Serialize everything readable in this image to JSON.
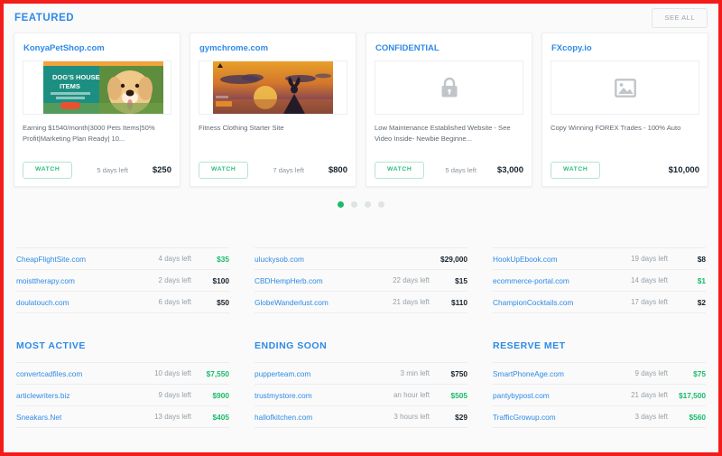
{
  "featured": {
    "title": "FEATURED",
    "see_all_label": "SEE ALL",
    "cards": [
      {
        "name": "KonyaPetShop.com",
        "thumb": "dog-pet-shop-banner",
        "description": "Earning $1540/month|3000 Pets Items|50% Profit|Marketing Plan Ready| 10...",
        "watch_label": "WATCH",
        "time_left": "5 days left",
        "price": "$250"
      },
      {
        "name": "gymchrome.com",
        "thumb": "yoga-sunset-banner",
        "description": "Fitness Clothing Starter Site",
        "watch_label": "WATCH",
        "time_left": "7 days left",
        "price": "$800"
      },
      {
        "name": "CONFIDENTIAL",
        "thumb": "lock-icon",
        "description": "Low Maintenance Established Website - See Video Inside- Newbie Beginne...",
        "watch_label": "WATCH",
        "time_left": "5 days left",
        "price": "$3,000"
      },
      {
        "name": "FXcopy.io",
        "thumb": "image-placeholder-icon",
        "description": "Copy Winning FOREX Trades - 100% Auto",
        "watch_label": "WATCH",
        "time_left": "",
        "price": "$10,000"
      }
    ],
    "dots": {
      "count": 4,
      "active_index": 0
    }
  },
  "mid_listings": [
    {
      "rows": [
        {
          "name": "CheapFlightSite.com",
          "time_left": "4 days left",
          "price": "$35",
          "price_color": "green"
        },
        {
          "name": "moisttherapy.com",
          "time_left": "2 days left",
          "price": "$100",
          "price_color": "dark"
        },
        {
          "name": "doulatouch.com",
          "time_left": "6 days left",
          "price": "$50",
          "price_color": "dark"
        }
      ]
    },
    {
      "rows": [
        {
          "name": "uluckysob.com",
          "time_left": "",
          "price": "$29,000",
          "price_color": "dark"
        },
        {
          "name": "CBDHempHerb.com",
          "time_left": "22 days left",
          "price": "$15",
          "price_color": "dark"
        },
        {
          "name": "GlobeWanderlust.com",
          "time_left": "21 days left",
          "price": "$110",
          "price_color": "dark"
        }
      ]
    },
    {
      "rows": [
        {
          "name": "HookUpEbook.com",
          "time_left": "19 days left",
          "price": "$8",
          "price_color": "dark"
        },
        {
          "name": "ecommerce-portal.com",
          "time_left": "14 days left",
          "price": "$1",
          "price_color": "green"
        },
        {
          "name": "ChampionCocktails.com",
          "time_left": "17 days left",
          "price": "$2",
          "price_color": "dark"
        }
      ]
    }
  ],
  "bottom_sections": [
    {
      "title": "MOST ACTIVE",
      "rows": [
        {
          "name": "convertcadfiles.com",
          "time_left": "10 days left",
          "price": "$7,550",
          "price_color": "green"
        },
        {
          "name": "articlewriters.biz",
          "time_left": "9 days left",
          "price": "$900",
          "price_color": "green"
        },
        {
          "name": "Sneakars.Net",
          "time_left": "13 days left",
          "price": "$405",
          "price_color": "green"
        }
      ]
    },
    {
      "title": "ENDING SOON",
      "rows": [
        {
          "name": "pupperteam.com",
          "time_left": "3 min left",
          "price": "$750",
          "price_color": "dark"
        },
        {
          "name": "trustmystore.com",
          "time_left": "an hour left",
          "price": "$505",
          "price_color": "green"
        },
        {
          "name": "hallofkitchen.com",
          "time_left": "3 hours left",
          "price": "$29",
          "price_color": "dark"
        }
      ]
    },
    {
      "title": "RESERVE MET",
      "rows": [
        {
          "name": "SmartPhoneAge.com",
          "time_left": "9 days left",
          "price": "$75",
          "price_color": "green"
        },
        {
          "name": "pantybypost.com",
          "time_left": "21 days left",
          "price": "$17,500",
          "price_color": "green"
        },
        {
          "name": "TrafficGrowup.com",
          "time_left": "3 days left",
          "price": "$560",
          "price_color": "green"
        }
      ]
    }
  ],
  "thumb_art": {
    "dog_banner_headline": "DOG'S HOUSE",
    "dog_banner_subhead": "ITEMS"
  },
  "colors": {
    "link_blue": "#2e8ae6",
    "accent_green": "#19bb6a",
    "price_dark": "#16222c",
    "frame_red": "#f41b1b"
  }
}
